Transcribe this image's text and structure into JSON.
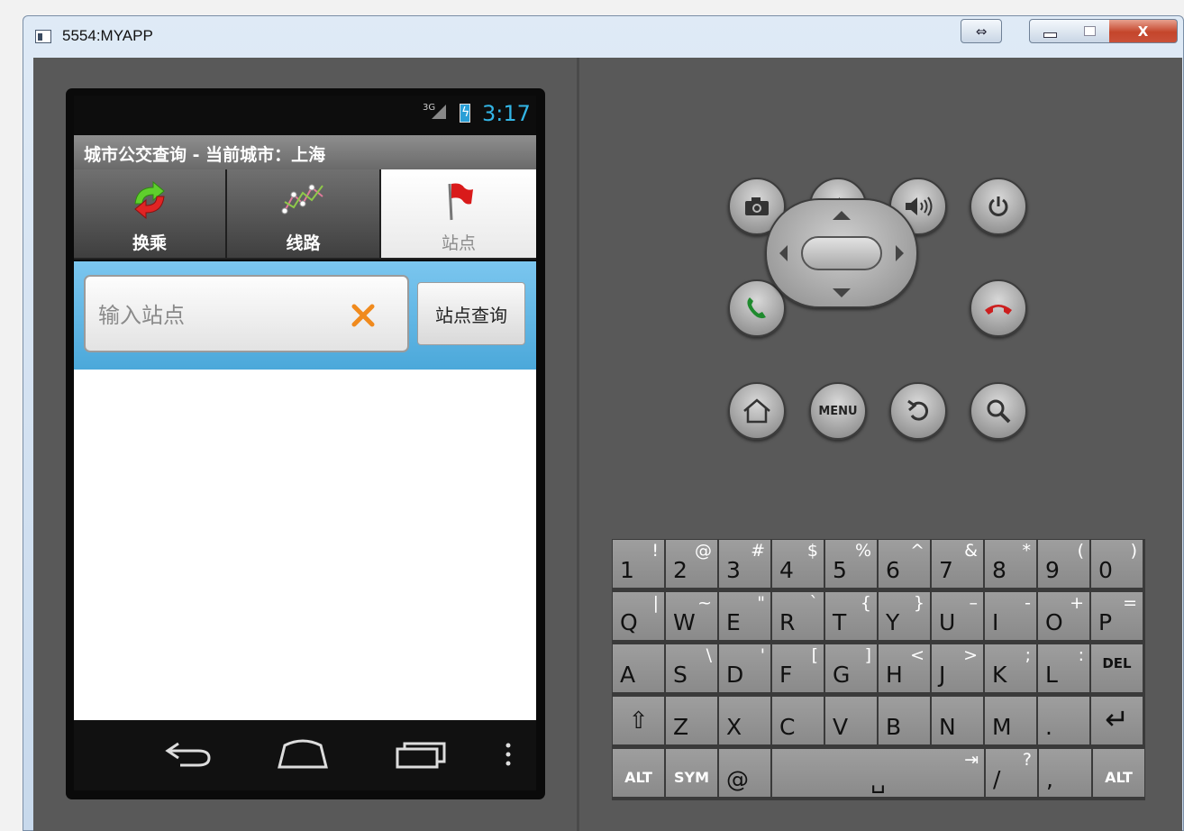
{
  "window": {
    "title": "5554:MYAPP",
    "buttons": {
      "resize": "⇔",
      "minimize": "▭",
      "maximize": "▢",
      "close": "X"
    }
  },
  "phone": {
    "status": {
      "network": "3G",
      "time": "3:17"
    },
    "app_title": "城市公交查询 - 当前城市：上海",
    "tabs": [
      {
        "label": "换乘",
        "icon": "transfer-arrows-icon",
        "active": false
      },
      {
        "label": "线路",
        "icon": "route-line-icon",
        "active": false
      },
      {
        "label": "站点",
        "icon": "red-flag-icon",
        "active": true
      }
    ],
    "search": {
      "placeholder": "输入站点",
      "value": "",
      "button_label": "站点查询"
    },
    "nav": {
      "back": "back-icon",
      "home": "home-icon",
      "recent": "recent-apps-icon",
      "menu": "overflow-menu-icon"
    }
  },
  "hardware_buttons": {
    "camera": "camera-icon",
    "volume_down": "volume-down-icon",
    "volume_up": "volume-up-icon",
    "power": "power-icon",
    "call": "call-icon",
    "end_call": "end-call-icon",
    "home": "home-icon",
    "menu_label": "MENU",
    "back": "back-icon",
    "search": "search-icon"
  },
  "keyboard": {
    "rows": [
      [
        {
          "main": "1",
          "alt": "!"
        },
        {
          "main": "2",
          "alt": "@"
        },
        {
          "main": "3",
          "alt": "#"
        },
        {
          "main": "4",
          "alt": "$"
        },
        {
          "main": "5",
          "alt": "%"
        },
        {
          "main": "6",
          "alt": "^"
        },
        {
          "main": "7",
          "alt": "&"
        },
        {
          "main": "8",
          "alt": "*"
        },
        {
          "main": "9",
          "alt": "("
        },
        {
          "main": "0",
          "alt": ")"
        }
      ],
      [
        {
          "main": "Q",
          "alt": "|"
        },
        {
          "main": "W",
          "alt": "~"
        },
        {
          "main": "E",
          "alt": "\""
        },
        {
          "main": "R",
          "alt": "`"
        },
        {
          "main": "T",
          "alt": "{"
        },
        {
          "main": "Y",
          "alt": "}"
        },
        {
          "main": "U",
          "alt": "–"
        },
        {
          "main": "I",
          "alt": "-"
        },
        {
          "main": "O",
          "alt": "+"
        },
        {
          "main": "P",
          "alt": "="
        }
      ],
      [
        {
          "main": "A",
          "alt": ""
        },
        {
          "main": "S",
          "alt": "\\"
        },
        {
          "main": "D",
          "alt": "'"
        },
        {
          "main": "F",
          "alt": "["
        },
        {
          "main": "G",
          "alt": "]"
        },
        {
          "main": "H",
          "alt": "<"
        },
        {
          "main": "J",
          "alt": ">"
        },
        {
          "main": "K",
          "alt": ";"
        },
        {
          "main": "L",
          "alt": ":"
        },
        {
          "main": "DEL",
          "alt": ""
        }
      ],
      [
        {
          "main": "⇧",
          "alt": ""
        },
        {
          "main": "Z",
          "alt": ""
        },
        {
          "main": "X",
          "alt": ""
        },
        {
          "main": "C",
          "alt": ""
        },
        {
          "main": "V",
          "alt": ""
        },
        {
          "main": "B",
          "alt": ""
        },
        {
          "main": "N",
          "alt": ""
        },
        {
          "main": "M",
          "alt": ""
        },
        {
          "main": ".",
          "alt": ""
        },
        {
          "main": "↵",
          "alt": ""
        }
      ]
    ],
    "bottom_row": [
      {
        "main": "ALT",
        "alt": ""
      },
      {
        "main": "SYM",
        "alt": ""
      },
      {
        "main": "@",
        "alt": ""
      },
      {
        "main": "␣",
        "alt": "⇥"
      },
      {
        "main": "/",
        "alt": "?"
      },
      {
        "main": ",",
        "alt": ""
      },
      {
        "main": "ALT",
        "alt": ""
      }
    ]
  }
}
